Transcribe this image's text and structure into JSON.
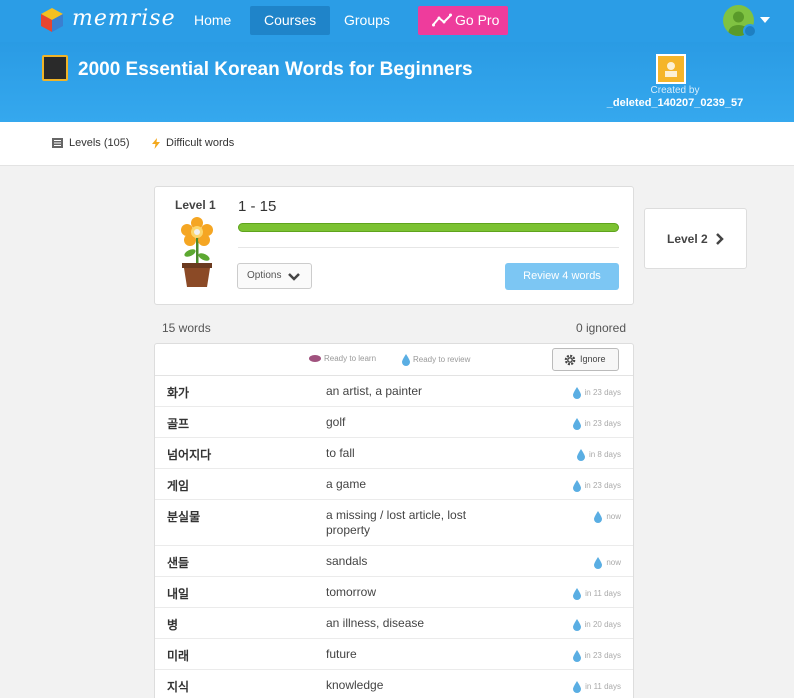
{
  "nav": {
    "brand": "memrise",
    "items": [
      {
        "label": "Home",
        "active": false
      },
      {
        "label": "Courses",
        "active": true
      },
      {
        "label": "Groups",
        "active": false
      }
    ],
    "go_pro": "Go Pro"
  },
  "course": {
    "title": "2000 Essential Korean Words for Beginners",
    "created_by_label": "Created by",
    "creator": "_deleted_140207_0239_57"
  },
  "tabs": {
    "levels": "Levels (105)",
    "difficult": "Difficult words"
  },
  "level": {
    "label": "Level 1",
    "range": "1 - 15",
    "progress": 1.0,
    "options_label": "Options",
    "review_label": "Review 4 words",
    "next_label": "Level 2"
  },
  "summary": {
    "words": "15 words",
    "ignored": "0 ignored"
  },
  "legend": {
    "ready_to_learn": "Ready to learn",
    "ready_to_review": "Ready to review",
    "ignore_label": "Ignore"
  },
  "words": [
    {
      "ko": "화가",
      "en": "an artist, a painter",
      "status": "in 23 days"
    },
    {
      "ko": "골프",
      "en": "golf",
      "status": "in 23 days"
    },
    {
      "ko": "넘어지다",
      "en": "to fall",
      "status": "in 8 days"
    },
    {
      "ko": "게임",
      "en": "a game",
      "status": "in 23 days"
    },
    {
      "ko": "분실물",
      "en": "a missing / lost article, lost property",
      "status": "now"
    },
    {
      "ko": "샌들",
      "en": "sandals",
      "status": "now"
    },
    {
      "ko": "내일",
      "en": "tomorrow",
      "status": "in 11 days"
    },
    {
      "ko": "병",
      "en": "an illness, disease",
      "status": "in 20 days"
    },
    {
      "ko": "미래",
      "en": "future",
      "status": "in 23 days"
    },
    {
      "ko": "지식",
      "en": "knowledge",
      "status": "in 11 days"
    }
  ],
  "colors": {
    "nav_bg": "#2b9de6",
    "go_pro": "#ee3c9c",
    "progress": "#7cc232",
    "review_btn": "#7cc6f3",
    "drop": "#5aaee3",
    "learn_eye": "#a0527e"
  }
}
